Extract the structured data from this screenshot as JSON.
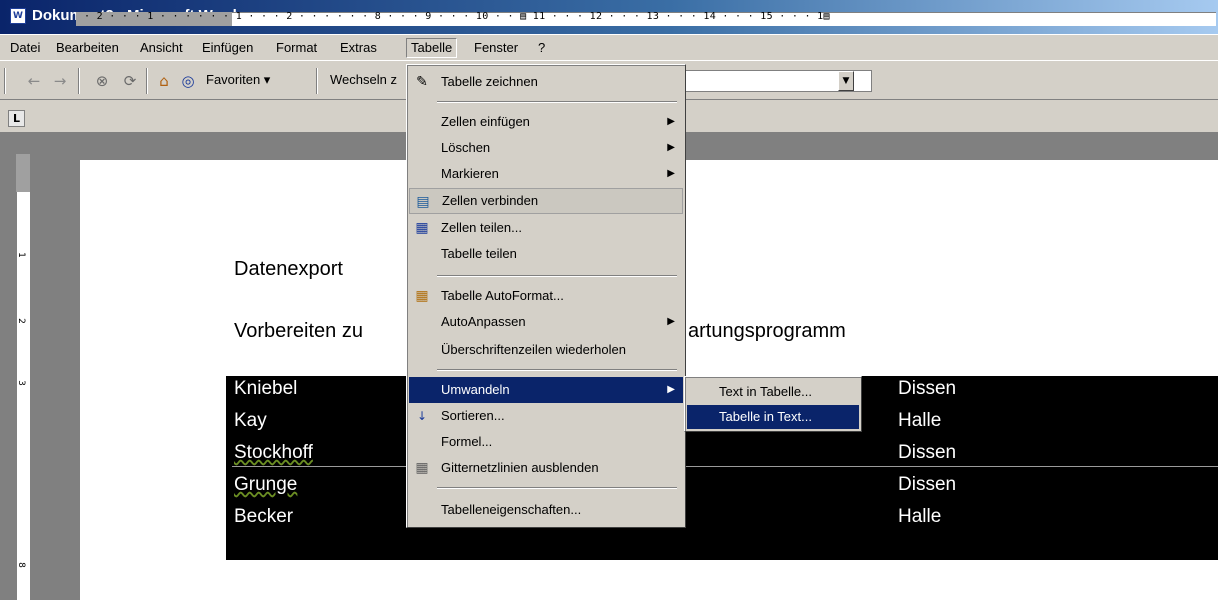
{
  "window": {
    "title": "Dokument2 - Microsoft Word",
    "icon": "word-doc-icon"
  },
  "menubar": [
    {
      "label": "Datei"
    },
    {
      "label": "Bearbeiten"
    },
    {
      "label": "Ansicht"
    },
    {
      "label": "Einfügen"
    },
    {
      "label": "Format"
    },
    {
      "label": "Extras"
    },
    {
      "label": "Tabelle",
      "active": true
    },
    {
      "label": "Fenster"
    },
    {
      "label": "?"
    }
  ],
  "toolbar": {
    "back": "←",
    "forward": "→",
    "stop": "⊗",
    "refresh": "⟳",
    "home": "⌂",
    "search": "◎",
    "favorites_label": "Favoriten ▾",
    "switch_label": "Wechseln z",
    "dropdown_arrow": "▼"
  },
  "ruler": {
    "corner": "L",
    "scale": "· 2 · · · 1 · · ·   · · · 1 · · · 2 · · ·                                                 · · · 8 · · · 9 · · · 10 · · ▤ 11 · · · 12 · · · 13 · · · 14 · · · 15 · · · 1▤",
    "v_numbers": [
      "1",
      "2",
      "3",
      "8"
    ]
  },
  "document": {
    "heading": "Datenexport",
    "subheading_left": "Vorbereiten zu",
    "subheading_right": "artungsprogramm",
    "rows": [
      {
        "name": "Kniebel",
        "city": "Dissen"
      },
      {
        "name": "Kay",
        "city": "Halle"
      },
      {
        "name": "Stockhoff",
        "city": "Dissen"
      },
      {
        "name": "Grunge",
        "city": "Dissen"
      },
      {
        "name": "Becker",
        "city": "Halle"
      }
    ]
  },
  "tabelle_menu": {
    "items": [
      {
        "label": "Tabelle zeichnen",
        "icon": "pencil-icon"
      },
      {
        "label": "Zellen einfügen",
        "submenu": true
      },
      {
        "label": "Löschen",
        "submenu": true
      },
      {
        "label": "Markieren",
        "submenu": true
      },
      {
        "label": "Zellen verbinden",
        "icon": "merge-cells-icon"
      },
      {
        "label": "Zellen teilen...",
        "icon": "split-cells-icon"
      },
      {
        "label": "Tabelle teilen"
      },
      {
        "label": "Tabelle AutoFormat...",
        "icon": "autoformat-icon"
      },
      {
        "label": "AutoAnpassen",
        "submenu": true
      },
      {
        "label": "Überschriftenzeilen wiederholen"
      },
      {
        "label": "Umwandeln",
        "submenu": true,
        "selected": true
      },
      {
        "label": "Sortieren...",
        "icon": "sort-az-icon"
      },
      {
        "label": "Formel..."
      },
      {
        "label": "Gitternetzlinien ausblenden",
        "icon": "gridlines-icon"
      },
      {
        "label": "Tabelleneigenschaften..."
      }
    ],
    "arrow": "▶"
  },
  "umwandeln_submenu": {
    "items": [
      {
        "label": "Text in Tabelle..."
      },
      {
        "label": "Tabelle in Text...",
        "selected": true
      }
    ]
  },
  "colors": {
    "highlight": "#0a246a",
    "face": "#d4d0c8",
    "table": "#000000"
  }
}
